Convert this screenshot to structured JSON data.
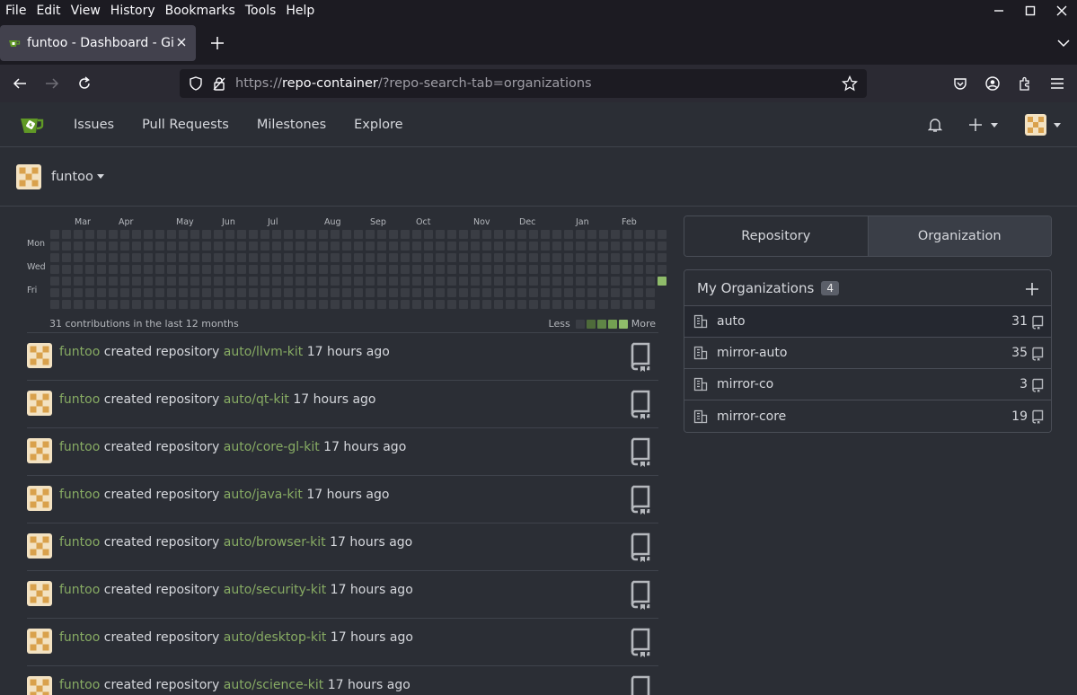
{
  "browser": {
    "menu": [
      "File",
      "Edit",
      "View",
      "History",
      "Bookmarks",
      "Tools",
      "Help"
    ],
    "tab_title": "funtoo - Dashboard - Gitea",
    "url_prefix": "https://",
    "url_host": "repo-container",
    "url_path": "/?repo-search-tab=organizations"
  },
  "nav": {
    "items": [
      "Issues",
      "Pull Requests",
      "Milestones",
      "Explore"
    ]
  },
  "context": {
    "user": "funtoo"
  },
  "heatmap": {
    "months": [
      "Mar",
      "Apr",
      "May",
      "Jun",
      "Jul",
      "Aug",
      "Sep",
      "Oct",
      "Nov",
      "Dec",
      "Jan",
      "Feb"
    ],
    "days": [
      "Mon",
      "Wed",
      "Fri"
    ],
    "summary": "31 contributions in the last 12 months",
    "less": "Less",
    "more": "More",
    "colors": [
      "#3a3d44",
      "#4e6b3a",
      "#5f8546",
      "#73a052",
      "#8fbc6a"
    ]
  },
  "feed": [
    {
      "user": "funtoo",
      "action": "created repository",
      "repo": "auto/llvm-kit",
      "time": "17 hours ago"
    },
    {
      "user": "funtoo",
      "action": "created repository",
      "repo": "auto/qt-kit",
      "time": "17 hours ago"
    },
    {
      "user": "funtoo",
      "action": "created repository",
      "repo": "auto/core-gl-kit",
      "time": "17 hours ago"
    },
    {
      "user": "funtoo",
      "action": "created repository",
      "repo": "auto/java-kit",
      "time": "17 hours ago"
    },
    {
      "user": "funtoo",
      "action": "created repository",
      "repo": "auto/browser-kit",
      "time": "17 hours ago"
    },
    {
      "user": "funtoo",
      "action": "created repository",
      "repo": "auto/security-kit",
      "time": "17 hours ago"
    },
    {
      "user": "funtoo",
      "action": "created repository",
      "repo": "auto/desktop-kit",
      "time": "17 hours ago"
    },
    {
      "user": "funtoo",
      "action": "created repository",
      "repo": "auto/science-kit",
      "time": "17 hours ago"
    }
  ],
  "panel": {
    "tabs": [
      "Repository",
      "Organization"
    ],
    "title": "My Organizations",
    "count": "4",
    "orgs": [
      {
        "name": "auto",
        "repos": "31"
      },
      {
        "name": "mirror-auto",
        "repos": "35"
      },
      {
        "name": "mirror-co",
        "repos": "3"
      },
      {
        "name": "mirror-core",
        "repos": "19"
      }
    ]
  },
  "colors": {
    "link": "#87ab63",
    "background": "#2b2e35",
    "chrome": "#1c1b22"
  }
}
